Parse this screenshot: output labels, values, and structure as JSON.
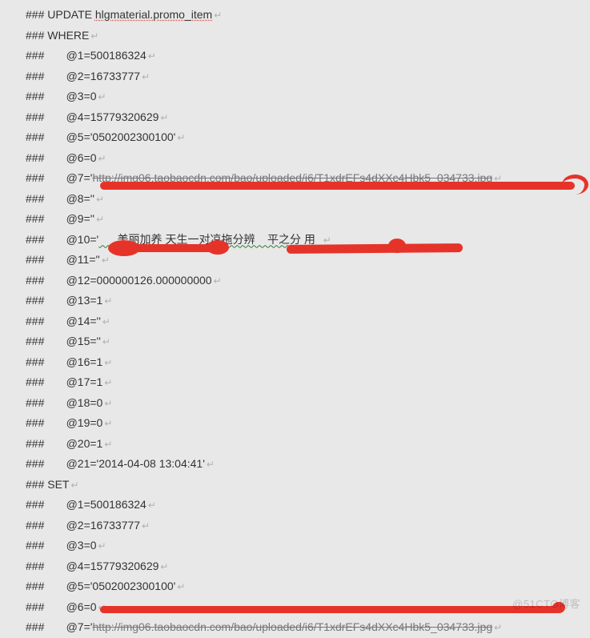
{
  "lines": {
    "update_hash": "### UPDATE ",
    "update_table": "hlgmaterial.promo_item",
    "where": "### WHERE",
    "p1": "###       @1=500186324",
    "p2": "###       @2=16733777",
    "p3": "###       @3=0",
    "p4": "###       @4=15779320629",
    "p5": "###       @5='0502002300100'",
    "p6": "###       @6=0",
    "p7a": "###       @7='",
    "p7b": "http://img06.taobaocdn.com/bao/uploaded/i6/T1xdrEFs4dXXc4Hbk5_034733.jpg",
    "p8": "###       @8=''",
    "p9": "###       @9=''",
    "p10a": "###       @10='",
    "p10b": "      美丽加养 天生一对凉拖分辨    平之分 用  ",
    "p10c": "",
    "p11": "###       @11=''",
    "p12": "###       @12=000000126.000000000",
    "p13": "###       @13=1",
    "p14": "###       @14=''",
    "p15": "###       @15=''",
    "p16": "###       @16=1",
    "p17": "###       @17=1",
    "p18": "###       @18=0",
    "p19": "###       @19=0",
    "p20": "###       @20=1",
    "p21": "###       @21='2014-04-08 13:04:41'",
    "set": "### SET",
    "s1": "###       @1=500186324",
    "s2": "###       @2=16733777",
    "s3": "###       @3=0",
    "s4": "###       @4=15779320629",
    "s5": "###       @5='0502002300100'",
    "s6": "###       @6=0",
    "s7a": "###       @7='",
    "s7b": "http://img06.taobaocdn.com/bao/uploaded/i6/T1xdrEFs4dXXc4Hbk5_034733.jpg"
  },
  "watermark": "@51CTO博客"
}
